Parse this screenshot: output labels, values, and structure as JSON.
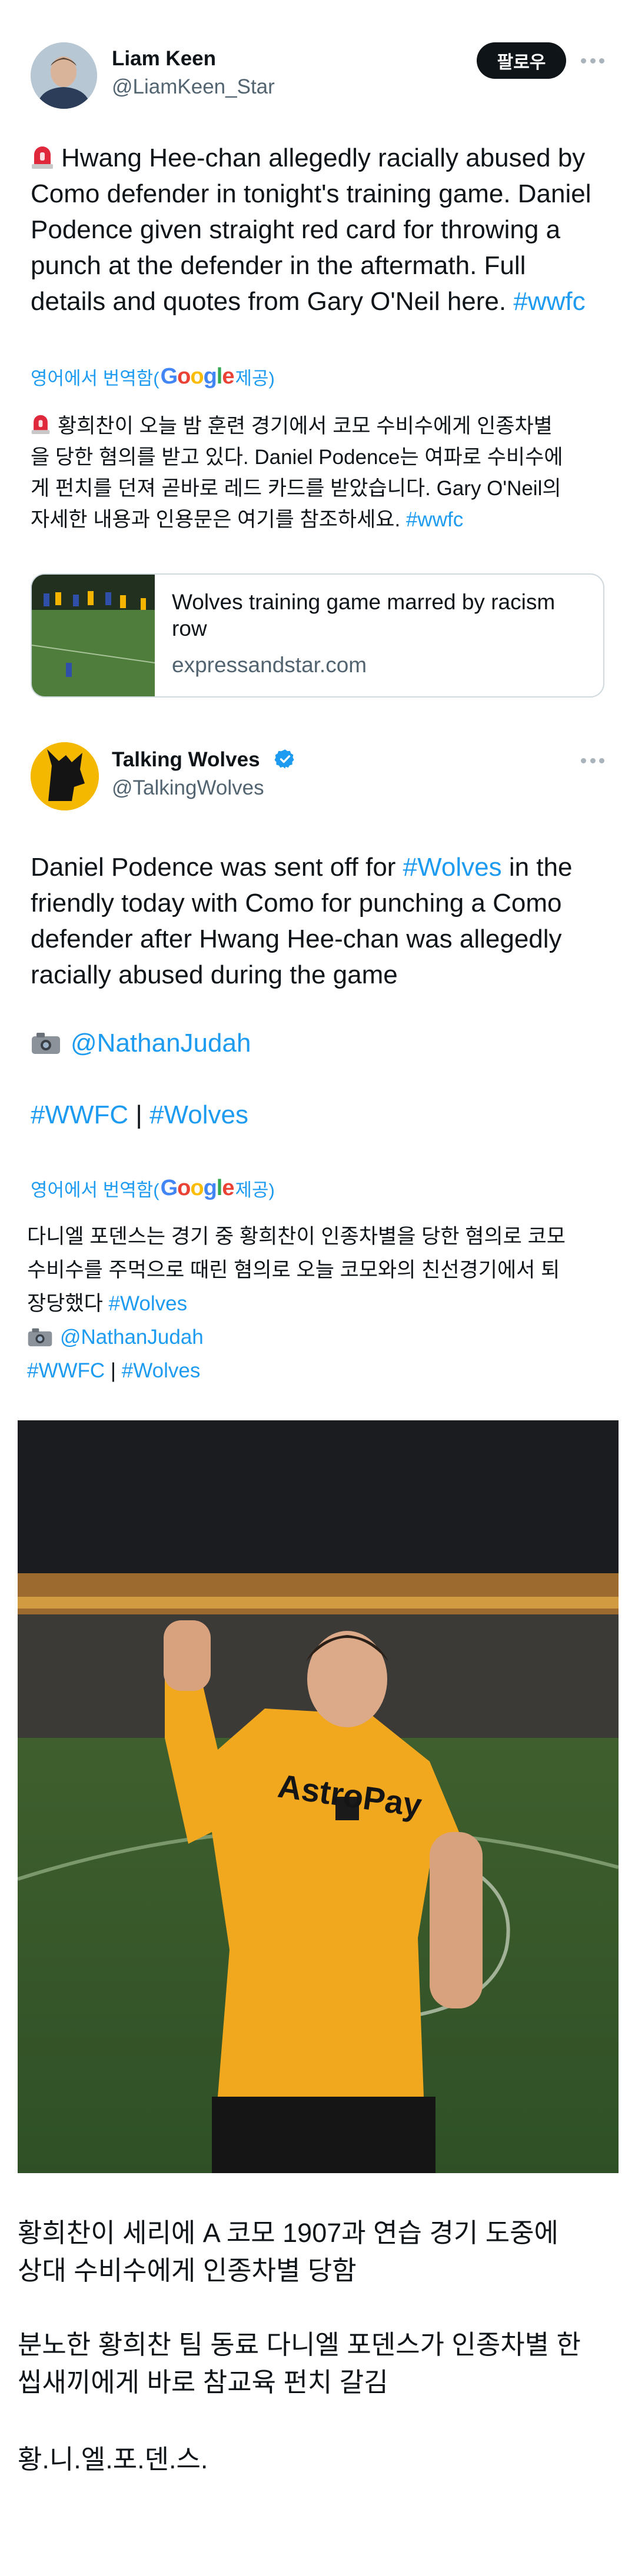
{
  "tweet1": {
    "name": "Liam Keen",
    "handle": "@LiamKeen_Star",
    "follow_label": "팔로우",
    "body_lines": [
      "Hwang Hee-chan allegedly racially abused by",
      "Como defender in tonight's training game. Daniel",
      "Podence given straight red card for throwing a",
      "punch at the defender in the aftermath. Full",
      "details and quotes from Gary O'Neil here. "
    ],
    "hashtag": "#wwfc",
    "translation_prefix": "영어에서 번역함(",
    "translation_suffix": " 제공)",
    "google_letters": [
      "G",
      "o",
      "o",
      "g",
      "l",
      "e"
    ],
    "translated_lines": [
      "황희찬이 오늘 밤 훈련 경기에서 코모 수비수에게 인종차별",
      "을 당한 혐의를 받고 있다. Daniel Podence는 여파로 수비수에",
      "게 펀치를 던져 곧바로 레드 카드를 받았습니다. Gary O'Neil의",
      "자세한 내용과 인용문은 여기를 참조하세요. "
    ],
    "translated_hashtag": "#wwfc",
    "card": {
      "title": "Wolves training game marred by racism row",
      "domain": "expressandstar.com"
    }
  },
  "tweet2": {
    "name": "Talking Wolves",
    "handle": "@TalkingWolves",
    "body_pre": "Daniel Podence was sent off for ",
    "body_hashtag": "#Wolves",
    "body_lines_rest": [
      "friendly today with Como for punching a Como",
      "defender after Hwang Hee-chan was allegedly",
      "racially abused during the game"
    ],
    "credit_mention": "@NathanJudah",
    "tags": [
      "#WWFC",
      "#Wolves"
    ],
    "tag_separator": " | ",
    "translation_prefix": "영어에서 번역함(",
    "translation_suffix": " 제공)",
    "translated_lines": [
      "다니엘 포덴스는 경기 중 황희찬이 인종차별을 당한 혐의로 코모",
      "수비수를 주먹으로 때린 혐의로 오늘 코모와의 친선경기에서 퇴",
      "장당했다 "
    ],
    "translated_hashtag": "#Wolves",
    "translated_mention": "@NathanJudah",
    "translated_tags": [
      "#WWFC",
      "#Wolves"
    ],
    "photo_shirt_text": "AstroPay"
  },
  "caption": {
    "para1": [
      "황희찬이 세리에 A 코모 1907과 연습 경기 도중에",
      "상대 수비수에게 인종차별 당함"
    ],
    "para2": [
      "분노한 황희찬 팀 동료 다니엘 포덴스가 인종차별 한",
      "씹새끼에게 바로 참교육 펀치 갈김"
    ],
    "para3": "황.니.엘.포.덴.스."
  },
  "colors": {
    "link": "#1d9bf0",
    "text": "#0f1419",
    "muted": "#536471",
    "border": "#cfd9de",
    "wolves_gold": "#f5b800"
  }
}
